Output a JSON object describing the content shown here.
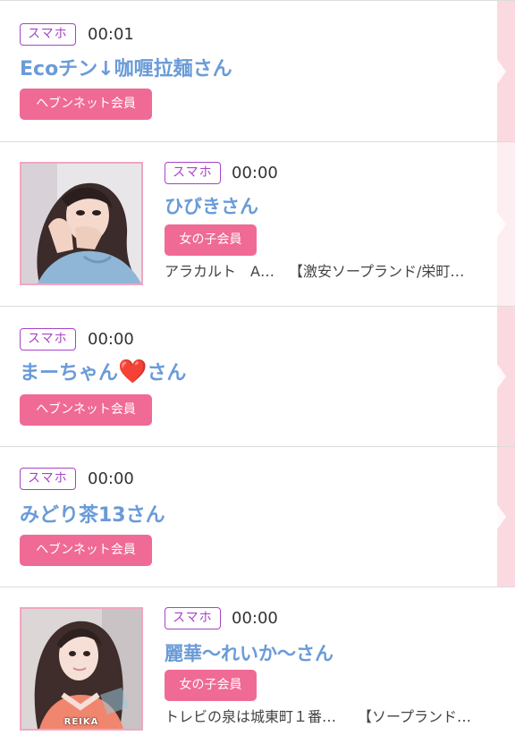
{
  "colors": {
    "device_border": "#a843c7",
    "name_blue": "#6a9bd8",
    "badge_pink": "#f06a96",
    "side_pink": "#fbd9e1",
    "divider": "#dcdcdc",
    "thumb_border": "#f1a6c0"
  },
  "entries": [
    {
      "device": "スマホ",
      "time": "00:01",
      "name": "Ecoチン↓咖喱拉麺さん",
      "badge": "ヘブンネット会員"
    },
    {
      "device": "スマホ",
      "time": "00:00",
      "name": "ひびきさん",
      "badge": "女の子会員",
      "thumbnail_icon": "girl-photo-icon",
      "shop_name": "アラカルト　A…",
      "shop_category": "【激安ソープランド/栄町…"
    },
    {
      "device": "スマホ",
      "time": "00:00",
      "name_prefix": "まーちゃん",
      "name_heart": "❤️",
      "name_suffix": "さん",
      "badge": "ヘブンネット会員"
    },
    {
      "device": "スマホ",
      "time": "00:00",
      "name": "みどり茶13さん",
      "badge": "ヘブンネット会員"
    },
    {
      "device": "スマホ",
      "time": "00:00",
      "name": "麗華〜れいか〜さん",
      "badge": "女の子会員",
      "thumbnail_icon": "girl-photo-icon",
      "thumbnail_caption": "REIKA",
      "shop_name": "トレビの泉は城東町１番…",
      "shop_category": "【ソープランド…"
    }
  ]
}
